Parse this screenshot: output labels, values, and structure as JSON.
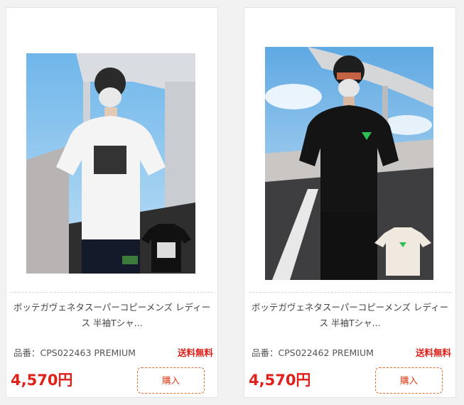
{
  "products": [
    {
      "title": "ボッテガヴェネタスーパーコピーメンズ レディース 半袖Tシャ...",
      "code": "品番：CPS022463 PREMIUM",
      "shipping": "送料無料",
      "price": "4,570円",
      "buy_label": "購入",
      "image_icon": "product-photo-white-tshirt"
    },
    {
      "title": "ボッテガヴェネタスーパーコピーメンズ レディース 半袖Tシャ...",
      "code": "品番：CPS022462 PREMIUM",
      "shipping": "送料無料",
      "price": "4,570円",
      "buy_label": "購入",
      "image_icon": "product-photo-black-tshirt"
    }
  ],
  "colors": {
    "price": "#e0201a",
    "shipping": "#e0201a",
    "buy_border": "#e06a2a"
  }
}
